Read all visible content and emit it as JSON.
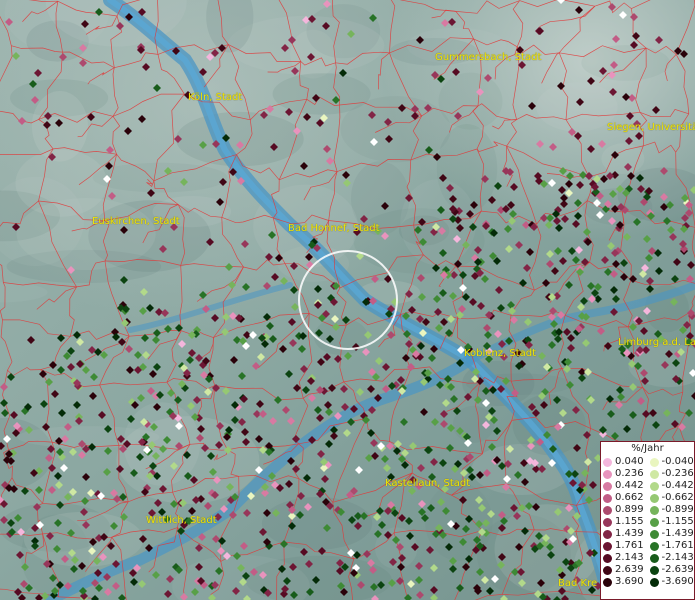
{
  "map": {
    "cities": [
      {
        "name": "Köln, Stadt"
      },
      {
        "name": "Gummersbach, Stadt"
      },
      {
        "name": "Siegen, Universitä"
      },
      {
        "name": "Euskirchen, Stadt"
      },
      {
        "name": "Bad Honnef, Stadt"
      },
      {
        "name": "Koblenz, Stadt"
      },
      {
        "name": "Limburg a.d. Lahn"
      },
      {
        "name": "Kastellaun, Stadt"
      },
      {
        "name": "Wittlich, Stadt"
      },
      {
        "name": "Bad Kre"
      }
    ]
  },
  "legend": {
    "title": "%/Jahr",
    "positive": [
      {
        "label": "0.040",
        "color": "#f4b6dc"
      },
      {
        "label": "0.236",
        "color": "#e893bd"
      },
      {
        "label": "0.442",
        "color": "#d87aa2"
      },
      {
        "label": "0.662",
        "color": "#c25d86"
      },
      {
        "label": "0.899",
        "color": "#ad4a6e"
      },
      {
        "label": "1.155",
        "color": "#97365a"
      },
      {
        "label": "1.439",
        "color": "#822546"
      },
      {
        "label": "1.761",
        "color": "#6c1633"
      },
      {
        "label": "2.143",
        "color": "#560b23"
      },
      {
        "label": "2.639",
        "color": "#400615"
      },
      {
        "label": "3.690",
        "color": "#2a020a"
      }
    ],
    "negative": [
      {
        "label": "-0.040",
        "color": "#e9f5bf"
      },
      {
        "label": "-0.236",
        "color": "#cfe8a3"
      },
      {
        "label": "-0.442",
        "color": "#b2d98a"
      },
      {
        "label": "-0.662",
        "color": "#95c873"
      },
      {
        "label": "-0.899",
        "color": "#76b45c"
      },
      {
        "label": "-1.155",
        "color": "#58a047"
      },
      {
        "label": "-1.439",
        "color": "#3e8a35"
      },
      {
        "label": "-1.761",
        "color": "#287327"
      },
      {
        "label": "-2.143",
        "color": "#185c1b"
      },
      {
        "label": "-2.639",
        "color": "#0c4411"
      },
      {
        "label": "-3.690",
        "color": "#042b08"
      }
    ]
  }
}
